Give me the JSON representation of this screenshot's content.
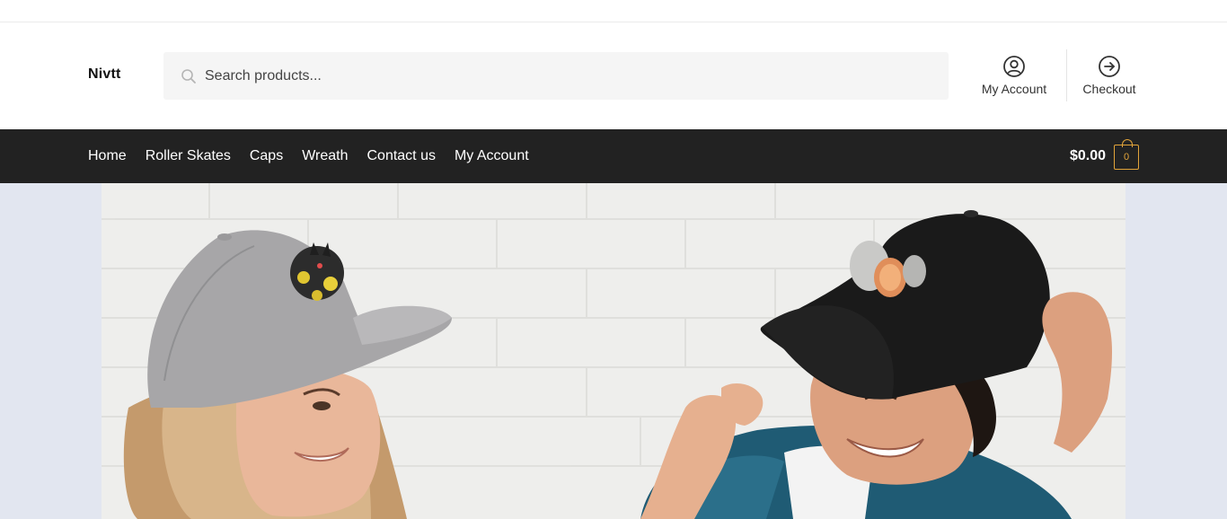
{
  "header": {
    "site_title": "Nivtt",
    "search": {
      "placeholder": "Search products...",
      "value": ""
    },
    "account_label": "My Account",
    "checkout_label": "Checkout"
  },
  "nav": {
    "items": [
      {
        "label": "Home"
      },
      {
        "label": "Roller Skates"
      },
      {
        "label": "Caps"
      },
      {
        "label": "Wreath"
      },
      {
        "label": "Contact us"
      },
      {
        "label": "My Account"
      }
    ]
  },
  "cart": {
    "total": "$0.00",
    "count": "0"
  },
  "hero": {
    "icon": "banner-image"
  },
  "colors": {
    "nav_background": "#222222",
    "accent": "#e2a43a",
    "page_background": "#e2e6f0"
  }
}
